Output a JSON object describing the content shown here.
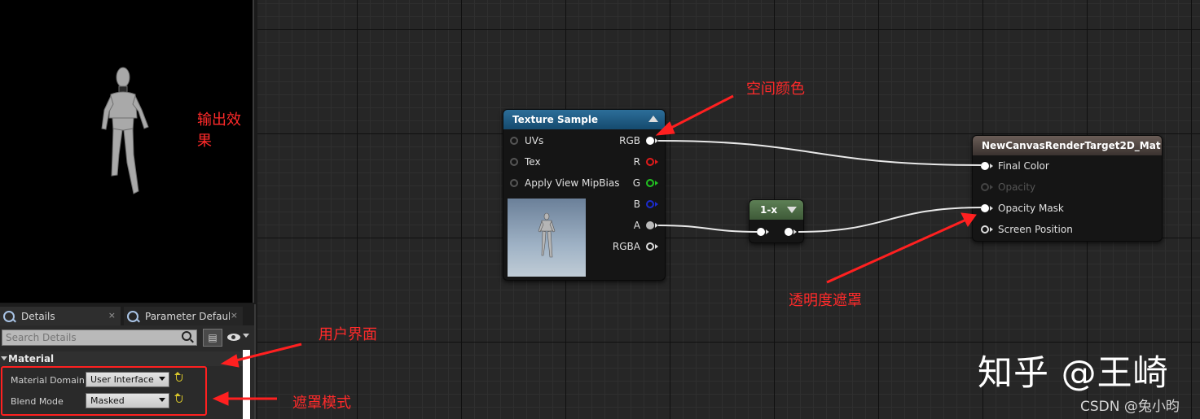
{
  "viewport": {
    "annotation": "输出效果"
  },
  "details_panel": {
    "tabs": [
      {
        "label": "Details",
        "close": "×"
      },
      {
        "label": "Parameter Defaults",
        "close": "×"
      }
    ],
    "search": {
      "placeholder": "Search Details"
    },
    "category": "Material",
    "properties": [
      {
        "label": "Material Domain",
        "value": "User Interface"
      },
      {
        "label": "Blend Mode",
        "value": "Masked"
      }
    ]
  },
  "texture_node": {
    "title": "Texture Sample",
    "header_color": "#1e5a80",
    "inputs": [
      "UVs",
      "Tex",
      "Apply View MipBias"
    ],
    "outputs": [
      {
        "label": "RGB",
        "color": "#ffffff"
      },
      {
        "label": "R",
        "color": "#e21b1b"
      },
      {
        "label": "G",
        "color": "#22c322"
      },
      {
        "label": "B",
        "color": "#1c2ccf"
      },
      {
        "label": "A",
        "color": "#bbbbbb"
      },
      {
        "label": "RGBA",
        "color": "#dddddd"
      }
    ]
  },
  "oneminus_node": {
    "title": "1-x",
    "header_color": "#4a6a44"
  },
  "material_node": {
    "title": "NewCanvasRenderTarget2D_Mat",
    "inputs": [
      {
        "label": "Final Color",
        "enabled": true
      },
      {
        "label": "Opacity",
        "enabled": false
      },
      {
        "label": "Opacity Mask",
        "enabled": true
      },
      {
        "label": "Screen Position",
        "enabled": true
      }
    ]
  },
  "annotations": {
    "space_color": "空间颜色",
    "opacity_mask": "透明度遮罩",
    "user_interface": "用户界面",
    "mask_mode": "遮罩模式",
    "color": "#ff2a2a"
  },
  "watermark": {
    "text": "知乎 @王崎",
    "credit": "CSDN @兔小昀"
  }
}
